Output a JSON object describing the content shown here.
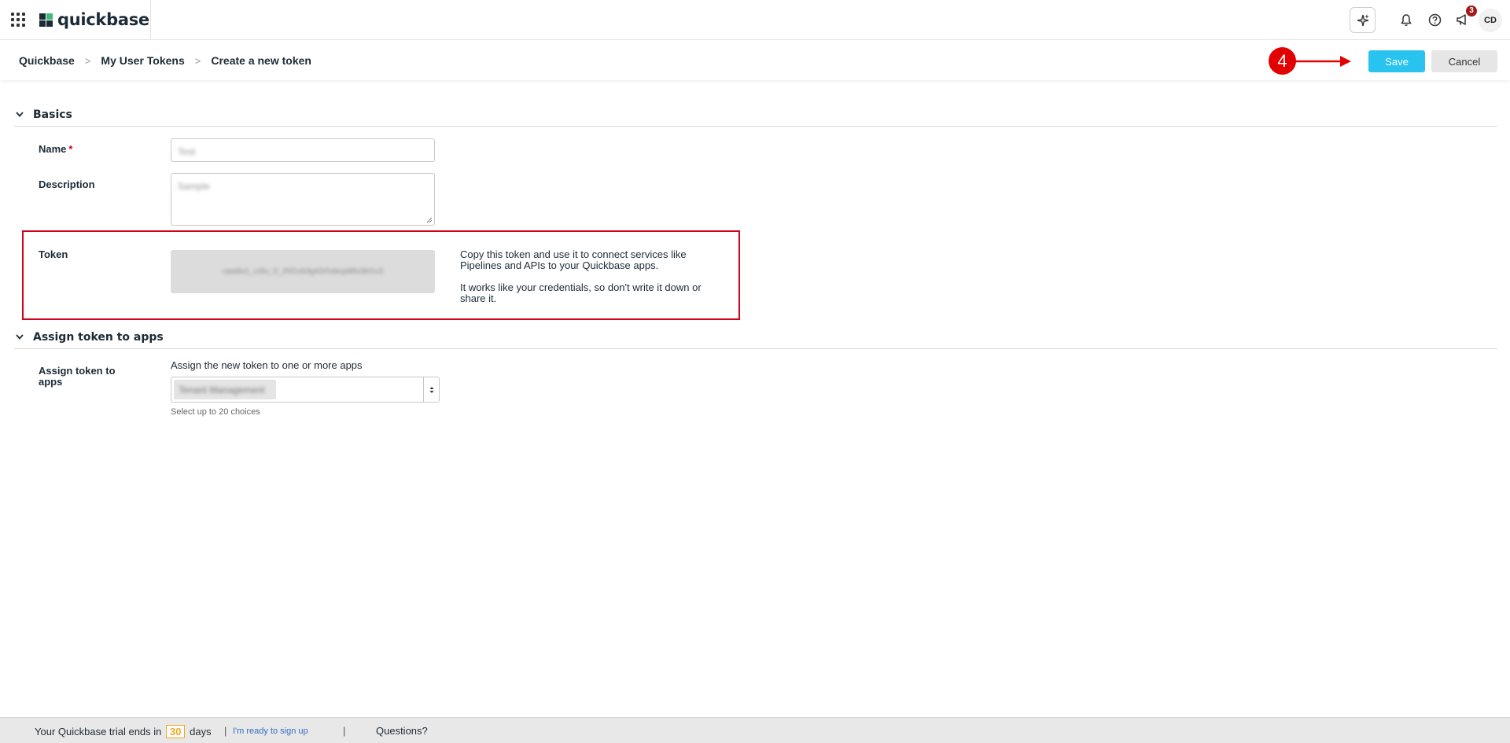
{
  "app": {
    "name": "quickbase"
  },
  "topbar": {
    "notification_count": "3",
    "user_initials": "CD"
  },
  "breadcrumb": {
    "items": [
      "Quickbase",
      "My User Tokens",
      "Create a new token"
    ]
  },
  "annotation": {
    "step_number": "4"
  },
  "toolbar": {
    "save_label": "Save",
    "cancel_label": "Cancel"
  },
  "sections": {
    "basics": {
      "title": "Basics"
    },
    "assign": {
      "title": "Assign token to apps"
    }
  },
  "fields": {
    "name": {
      "label": "Name",
      "required_mark": "*",
      "value": "Test"
    },
    "description": {
      "label": "Description",
      "value": "Sample"
    },
    "token": {
      "label": "Token",
      "value": "caw8s1_rz8u_0_2hf1vb3g43r5xbcpt8fu3kt1v3",
      "help_1": "Copy this token and use it to connect services like Pipelines and APIs to your Quickbase apps.",
      "help_2": "It works like your credentials, so don't write it down or share it."
    },
    "apps": {
      "label": "Assign token to apps",
      "intro": "Assign the new token to one or more apps",
      "selected": "Tenant Management",
      "helper": "Select up to 20 choices"
    }
  },
  "footer": {
    "trial_prefix": "Your Quickbase trial ends in",
    "days": "30",
    "days_suffix": "days",
    "signup_link": "I'm ready to sign up",
    "questions": "Questions?"
  },
  "colors": {
    "accent": "#28c3ee",
    "annotation_red": "#e30000",
    "highlight_border": "#d0021b"
  }
}
